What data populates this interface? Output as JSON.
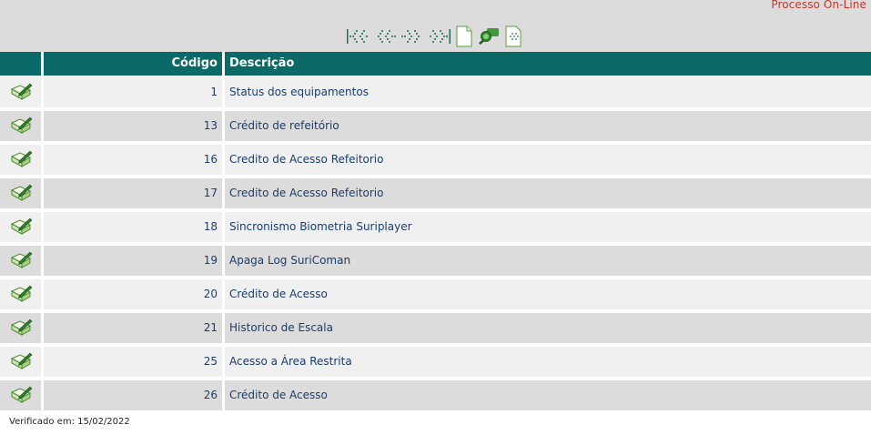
{
  "header": {
    "process_title": "Processo On-Line"
  },
  "toolbar": {
    "buttons": [
      {
        "name": "first-page-icon"
      },
      {
        "name": "previous-page-icon"
      },
      {
        "name": "next-page-icon"
      },
      {
        "name": "last-page-icon"
      },
      {
        "name": "new-record-icon"
      },
      {
        "name": "search-icon"
      },
      {
        "name": "back-icon"
      }
    ]
  },
  "table": {
    "columns": {
      "code": "Código",
      "description": "Descrição"
    },
    "rows": [
      {
        "code": "1",
        "description": "Status dos equipamentos"
      },
      {
        "code": "13",
        "description": "Crédito de refeitório"
      },
      {
        "code": "16",
        "description": "Credito de Acesso Refeitorio"
      },
      {
        "code": "17",
        "description": "Credito de Acesso Refeitorio"
      },
      {
        "code": "18",
        "description": "Sincronismo Biometria Suriplayer"
      },
      {
        "code": "19",
        "description": "Apaga Log SuriComan"
      },
      {
        "code": "20",
        "description": "Crédito de Acesso"
      },
      {
        "code": "21",
        "description": "Historico de Escala"
      },
      {
        "code": "25",
        "description": "Acesso a Área Restrita"
      },
      {
        "code": "26",
        "description": "Crédito de Acesso"
      }
    ],
    "row_action_icon": "edit-icon"
  },
  "footer": {
    "verified_text": "Verificado em: 15/02/2022"
  },
  "colors": {
    "header_bg": "#0b6a67",
    "title_red": "#c0392b",
    "link_blue": "#1a3d6b",
    "row_light": "#f0f0f0",
    "row_dark": "#dcdcdc"
  }
}
